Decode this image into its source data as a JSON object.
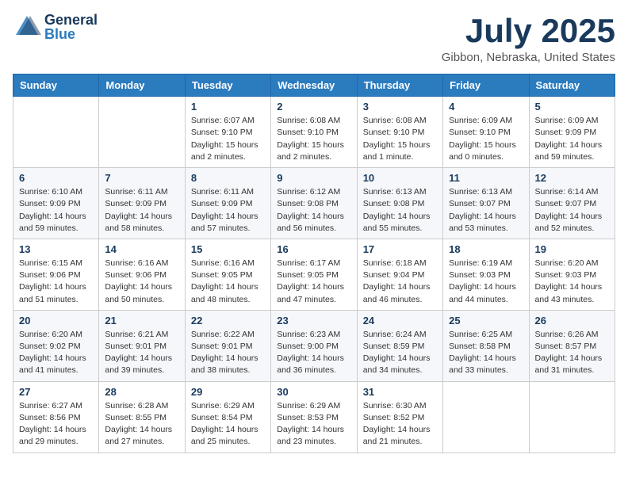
{
  "header": {
    "logo_general": "General",
    "logo_blue": "Blue",
    "month_title": "July 2025",
    "location": "Gibbon, Nebraska, United States"
  },
  "weekdays": [
    "Sunday",
    "Monday",
    "Tuesday",
    "Wednesday",
    "Thursday",
    "Friday",
    "Saturday"
  ],
  "weeks": [
    [
      {
        "day": "",
        "info": ""
      },
      {
        "day": "",
        "info": ""
      },
      {
        "day": "1",
        "info": "Sunrise: 6:07 AM\nSunset: 9:10 PM\nDaylight: 15 hours\nand 2 minutes."
      },
      {
        "day": "2",
        "info": "Sunrise: 6:08 AM\nSunset: 9:10 PM\nDaylight: 15 hours\nand 2 minutes."
      },
      {
        "day": "3",
        "info": "Sunrise: 6:08 AM\nSunset: 9:10 PM\nDaylight: 15 hours\nand 1 minute."
      },
      {
        "day": "4",
        "info": "Sunrise: 6:09 AM\nSunset: 9:10 PM\nDaylight: 15 hours\nand 0 minutes."
      },
      {
        "day": "5",
        "info": "Sunrise: 6:09 AM\nSunset: 9:09 PM\nDaylight: 14 hours\nand 59 minutes."
      }
    ],
    [
      {
        "day": "6",
        "info": "Sunrise: 6:10 AM\nSunset: 9:09 PM\nDaylight: 14 hours\nand 59 minutes."
      },
      {
        "day": "7",
        "info": "Sunrise: 6:11 AM\nSunset: 9:09 PM\nDaylight: 14 hours\nand 58 minutes."
      },
      {
        "day": "8",
        "info": "Sunrise: 6:11 AM\nSunset: 9:09 PM\nDaylight: 14 hours\nand 57 minutes."
      },
      {
        "day": "9",
        "info": "Sunrise: 6:12 AM\nSunset: 9:08 PM\nDaylight: 14 hours\nand 56 minutes."
      },
      {
        "day": "10",
        "info": "Sunrise: 6:13 AM\nSunset: 9:08 PM\nDaylight: 14 hours\nand 55 minutes."
      },
      {
        "day": "11",
        "info": "Sunrise: 6:13 AM\nSunset: 9:07 PM\nDaylight: 14 hours\nand 53 minutes."
      },
      {
        "day": "12",
        "info": "Sunrise: 6:14 AM\nSunset: 9:07 PM\nDaylight: 14 hours\nand 52 minutes."
      }
    ],
    [
      {
        "day": "13",
        "info": "Sunrise: 6:15 AM\nSunset: 9:06 PM\nDaylight: 14 hours\nand 51 minutes."
      },
      {
        "day": "14",
        "info": "Sunrise: 6:16 AM\nSunset: 9:06 PM\nDaylight: 14 hours\nand 50 minutes."
      },
      {
        "day": "15",
        "info": "Sunrise: 6:16 AM\nSunset: 9:05 PM\nDaylight: 14 hours\nand 48 minutes."
      },
      {
        "day": "16",
        "info": "Sunrise: 6:17 AM\nSunset: 9:05 PM\nDaylight: 14 hours\nand 47 minutes."
      },
      {
        "day": "17",
        "info": "Sunrise: 6:18 AM\nSunset: 9:04 PM\nDaylight: 14 hours\nand 46 minutes."
      },
      {
        "day": "18",
        "info": "Sunrise: 6:19 AM\nSunset: 9:03 PM\nDaylight: 14 hours\nand 44 minutes."
      },
      {
        "day": "19",
        "info": "Sunrise: 6:20 AM\nSunset: 9:03 PM\nDaylight: 14 hours\nand 43 minutes."
      }
    ],
    [
      {
        "day": "20",
        "info": "Sunrise: 6:20 AM\nSunset: 9:02 PM\nDaylight: 14 hours\nand 41 minutes."
      },
      {
        "day": "21",
        "info": "Sunrise: 6:21 AM\nSunset: 9:01 PM\nDaylight: 14 hours\nand 39 minutes."
      },
      {
        "day": "22",
        "info": "Sunrise: 6:22 AM\nSunset: 9:01 PM\nDaylight: 14 hours\nand 38 minutes."
      },
      {
        "day": "23",
        "info": "Sunrise: 6:23 AM\nSunset: 9:00 PM\nDaylight: 14 hours\nand 36 minutes."
      },
      {
        "day": "24",
        "info": "Sunrise: 6:24 AM\nSunset: 8:59 PM\nDaylight: 14 hours\nand 34 minutes."
      },
      {
        "day": "25",
        "info": "Sunrise: 6:25 AM\nSunset: 8:58 PM\nDaylight: 14 hours\nand 33 minutes."
      },
      {
        "day": "26",
        "info": "Sunrise: 6:26 AM\nSunset: 8:57 PM\nDaylight: 14 hours\nand 31 minutes."
      }
    ],
    [
      {
        "day": "27",
        "info": "Sunrise: 6:27 AM\nSunset: 8:56 PM\nDaylight: 14 hours\nand 29 minutes."
      },
      {
        "day": "28",
        "info": "Sunrise: 6:28 AM\nSunset: 8:55 PM\nDaylight: 14 hours\nand 27 minutes."
      },
      {
        "day": "29",
        "info": "Sunrise: 6:29 AM\nSunset: 8:54 PM\nDaylight: 14 hours\nand 25 minutes."
      },
      {
        "day": "30",
        "info": "Sunrise: 6:29 AM\nSunset: 8:53 PM\nDaylight: 14 hours\nand 23 minutes."
      },
      {
        "day": "31",
        "info": "Sunrise: 6:30 AM\nSunset: 8:52 PM\nDaylight: 14 hours\nand 21 minutes."
      },
      {
        "day": "",
        "info": ""
      },
      {
        "day": "",
        "info": ""
      }
    ]
  ]
}
